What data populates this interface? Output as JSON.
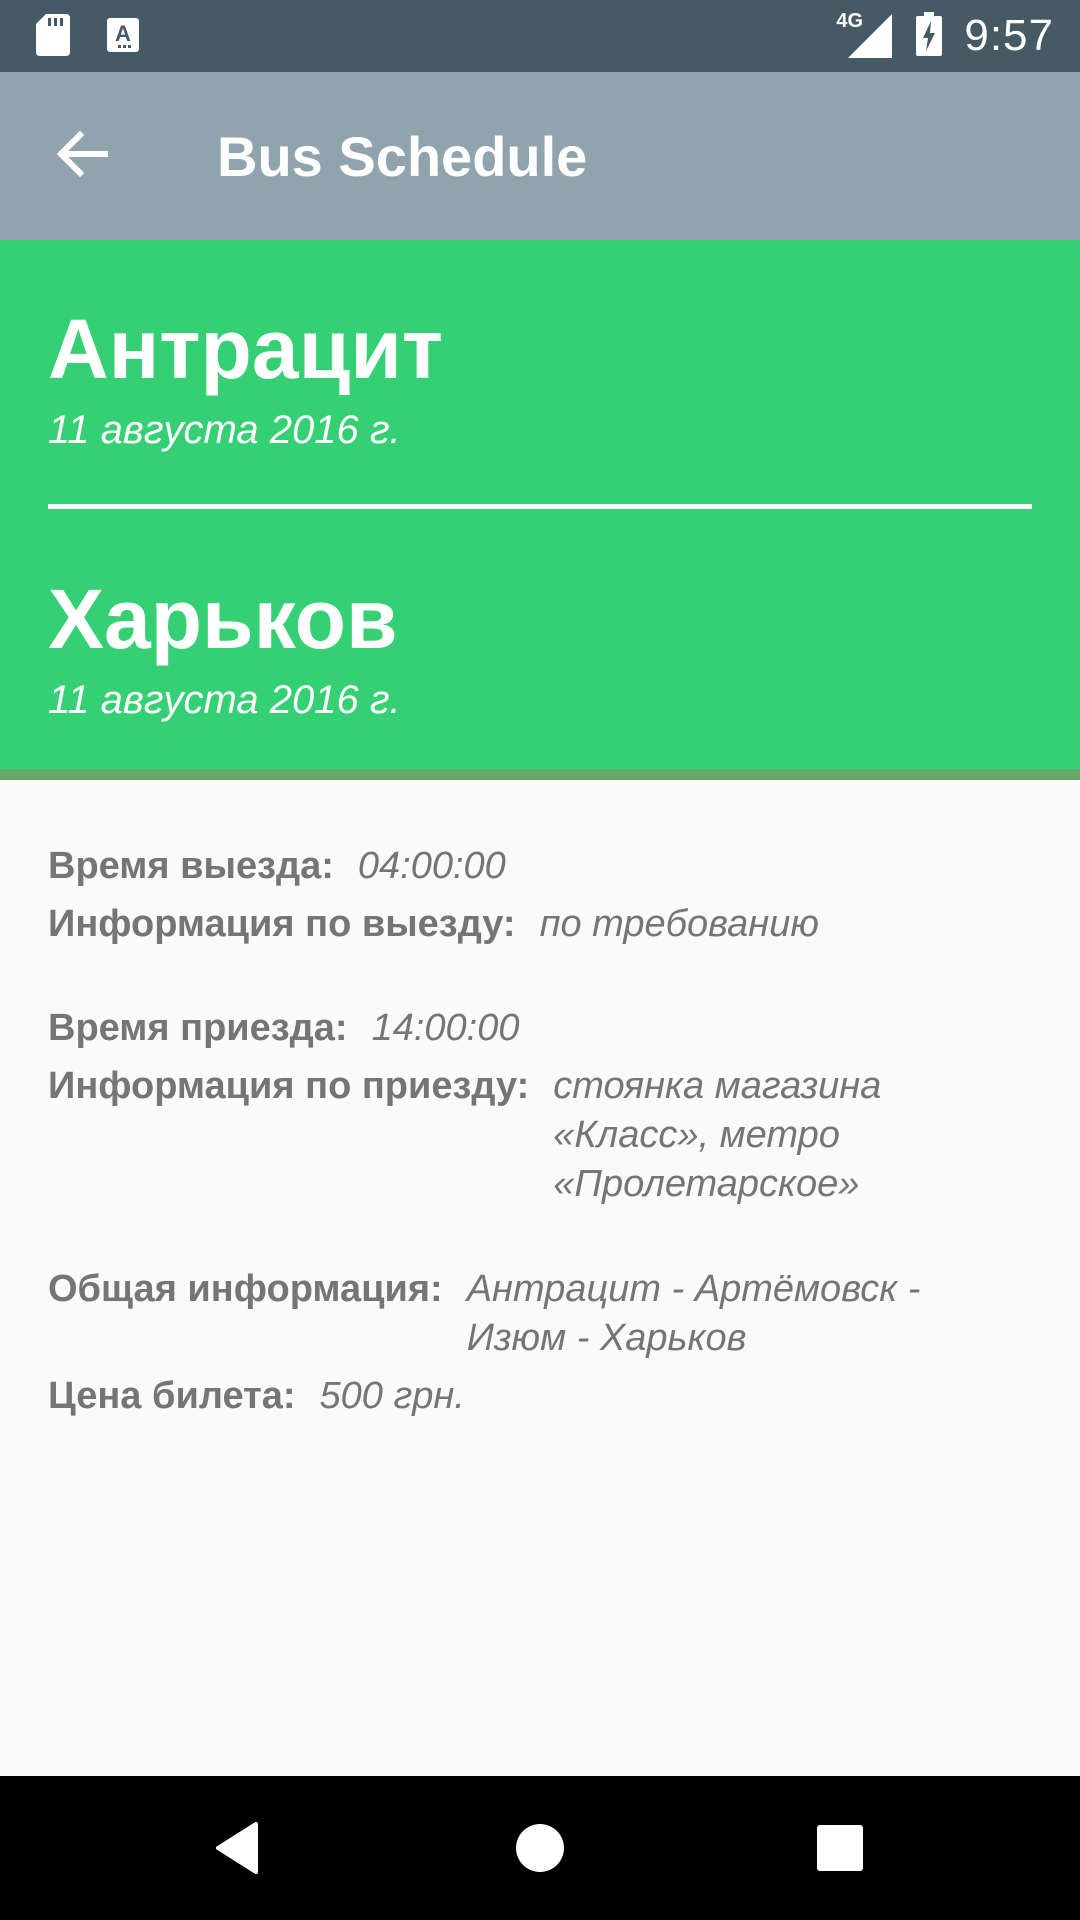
{
  "status_bar": {
    "network": "4G",
    "time": "9:57",
    "icons": [
      "sd-card-icon",
      "text-a-icon",
      "signal-icon",
      "battery-charging-icon"
    ]
  },
  "app_bar": {
    "title": "Bus Schedule",
    "back_icon": "arrow-back-icon"
  },
  "route": {
    "origin": {
      "city": "Антрацит",
      "date": "11 августа 2016 г."
    },
    "destination": {
      "city": "Харьков",
      "date": "11 августа 2016 г."
    }
  },
  "details": {
    "departure_time": {
      "label": "Время выезда:",
      "value": "04:00:00"
    },
    "departure_info": {
      "label": "Информация по выезду:",
      "value": "по требованию"
    },
    "arrival_time": {
      "label": "Время приезда:",
      "value": "14:00:00"
    },
    "arrival_info": {
      "label": "Информация по приезду:",
      "value": "стоянка магазина «Класс», метро «Пролетарское»"
    },
    "general_info": {
      "label": "Общая информация:",
      "value": "Антрацит - Артёмовск - Изюм - Харьков"
    },
    "price": {
      "label": "Цена билета:",
      "value": "500 грн."
    }
  },
  "colors": {
    "status_bar": "#455a64",
    "app_bar": "#90a4ae",
    "header": "#35d074",
    "header_border": "#66a866",
    "text_gray": "#757575"
  },
  "nav_bar": {
    "icons": [
      "nav-back-icon",
      "nav-home-icon",
      "nav-recents-icon"
    ]
  }
}
